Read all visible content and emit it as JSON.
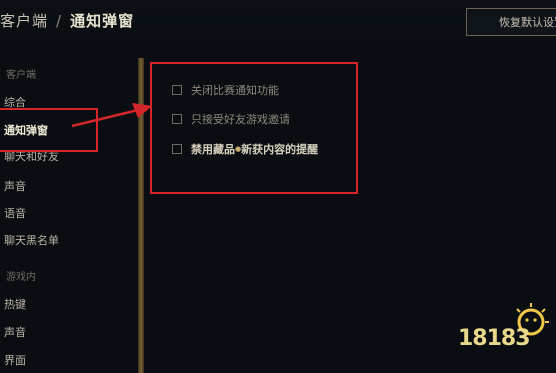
{
  "header": {
    "breadcrumb_parent": "客户端",
    "breadcrumb_sep": "/",
    "breadcrumb_current": "通知弹窗",
    "reset_button": "恢复默认设置"
  },
  "sidebar": {
    "client_section": "客户端",
    "client_items": [
      "综合",
      "通知弹窗",
      "聊天和好友",
      "声音",
      "语音",
      "聊天黑名单"
    ],
    "ingame_section": "游戏内",
    "ingame_items": [
      "热键",
      "声音",
      "界面"
    ]
  },
  "options": [
    {
      "label": "关闭比赛通知功能",
      "checked": false
    },
    {
      "label": "只接受好友游戏邀请",
      "checked": false
    },
    {
      "label_part1": "禁用藏品",
      "label_dot": "●",
      "label_part2": "新获内容的提醒",
      "checked": false
    }
  ],
  "watermark": {
    "text": "18183"
  },
  "colors": {
    "highlight": "#d3262b",
    "accent_gold": "#c8aa6e"
  }
}
